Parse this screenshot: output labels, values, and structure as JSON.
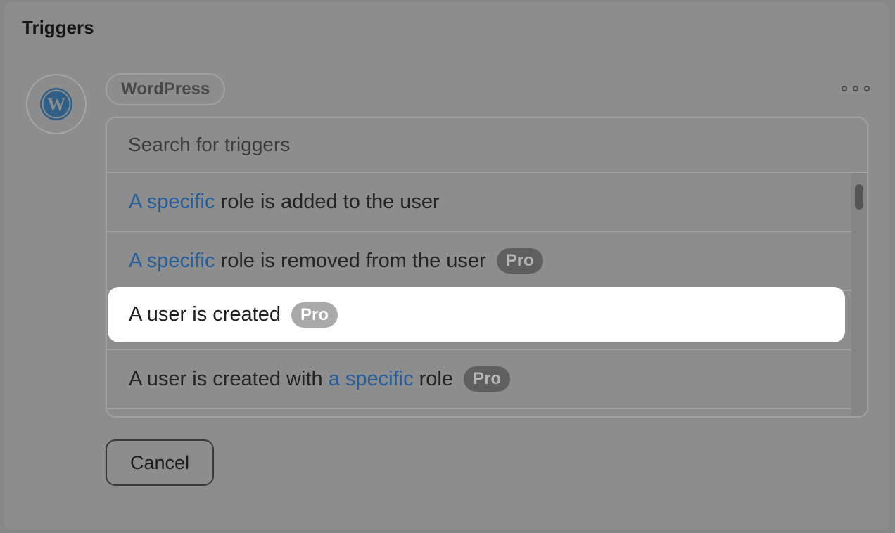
{
  "section": {
    "title": "Triggers"
  },
  "integration": {
    "name": "WordPress",
    "icon": "wordpress-logo-icon",
    "more_icon": "more-options-icon"
  },
  "search": {
    "placeholder": "Search for triggers"
  },
  "triggers": [
    {
      "parts": [
        "A specific",
        " role is added to the user"
      ],
      "highlight": "A specific",
      "badge": ""
    },
    {
      "parts": [
        "A specific",
        " role is removed from the user"
      ],
      "highlight": "A specific",
      "badge": "Pro"
    },
    {
      "parts": [
        "A user is created",
        ""
      ],
      "highlight": "",
      "badge": "Pro",
      "focused": true
    },
    {
      "pre": "A user is created with ",
      "highlight": "a specific",
      "post": " role",
      "badge": "Pro"
    }
  ],
  "colors": {
    "highlight_text": "#255e9c",
    "overlay": "#878787",
    "focused_bg": "#ffffff"
  },
  "actions": {
    "cancel_label": "Cancel"
  }
}
